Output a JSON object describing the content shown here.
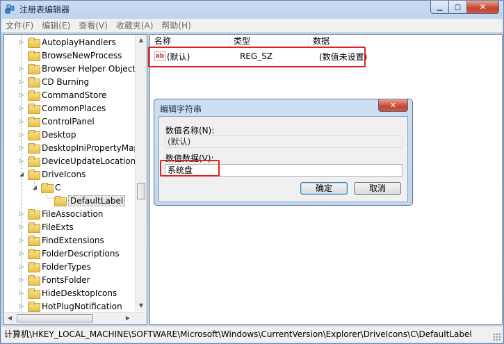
{
  "window": {
    "title": "注册表编辑器",
    "minimize_glyph": "▁",
    "maximize_glyph": "▢",
    "close_glyph": "✕",
    "icon": "regedit-icon"
  },
  "menu": [
    "文件(F)",
    "编辑(E)",
    "查看(V)",
    "收藏夹(A)",
    "帮助(H)"
  ],
  "tree": {
    "items": [
      {
        "label": "AutoplayHandlers",
        "indent": 0,
        "expander": "▷"
      },
      {
        "label": "BrowseNewProcess",
        "indent": 0,
        "expander": ""
      },
      {
        "label": "Browser Helper Objects",
        "indent": 0,
        "expander": "▷"
      },
      {
        "label": "CD Burning",
        "indent": 0,
        "expander": "▷"
      },
      {
        "label": "CommandStore",
        "indent": 0,
        "expander": "▷"
      },
      {
        "label": "CommonPlaces",
        "indent": 0,
        "expander": "▷"
      },
      {
        "label": "ControlPanel",
        "indent": 0,
        "expander": "▷"
      },
      {
        "label": "Desktop",
        "indent": 0,
        "expander": "▷"
      },
      {
        "label": "DesktopIniPropertyMap",
        "indent": 0,
        "expander": "▷"
      },
      {
        "label": "DeviceUpdateLocations",
        "indent": 0,
        "expander": "▷"
      },
      {
        "label": "DriveIcons",
        "indent": 0,
        "expander": "◢"
      },
      {
        "label": "C",
        "indent": 1,
        "expander": "◢"
      },
      {
        "label": "DefaultLabel",
        "indent": 2,
        "expander": "",
        "selected": true
      },
      {
        "label": "FileAssociation",
        "indent": 0,
        "expander": "▷"
      },
      {
        "label": "FileExts",
        "indent": 0,
        "expander": "▷"
      },
      {
        "label": "FindExtensions",
        "indent": 0,
        "expander": "▷"
      },
      {
        "label": "FolderDescriptions",
        "indent": 0,
        "expander": "▷"
      },
      {
        "label": "FolderTypes",
        "indent": 0,
        "expander": "▷"
      },
      {
        "label": "FontsFolder",
        "indent": 0,
        "expander": "▷"
      },
      {
        "label": "HideDesktopIcons",
        "indent": 0,
        "expander": "▷"
      },
      {
        "label": "HotPlugNotification",
        "indent": 0,
        "expander": "▷"
      }
    ],
    "scroll_up": "▲",
    "scroll_down": "▼",
    "scroll_left": "◀",
    "scroll_right": "▶"
  },
  "values": {
    "headers": [
      "名称",
      "类型",
      "数据"
    ],
    "rows": [
      {
        "icon": "ab",
        "name": "(默认)",
        "type": "REG_SZ",
        "data": "(数值未设置)"
      }
    ]
  },
  "dialog": {
    "title": "编辑字符串",
    "close_glyph": "✕",
    "name_label": "数值名称(N):",
    "name_value": "(默认)",
    "data_label": "数值数据(V):",
    "data_value": "系统盘",
    "ok_label": "确定",
    "cancel_label": "取消"
  },
  "status_path": "计算机\\HKEY_LOCAL_MACHINE\\SOFTWARE\\Microsoft\\Windows\\CurrentVersion\\Explorer\\DriveIcons\\C\\DefaultLabel",
  "colors": {
    "highlight_box": "#e02020",
    "window_frame": "#c2d7ef"
  }
}
